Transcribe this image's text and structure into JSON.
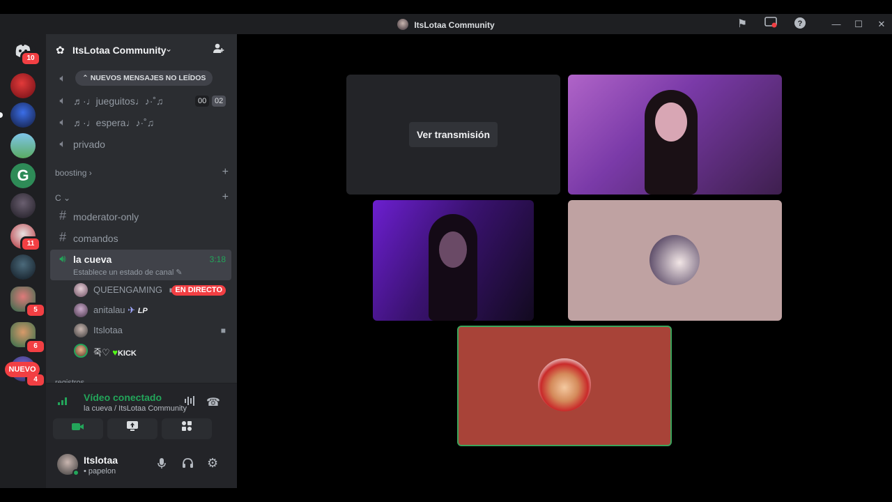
{
  "window": {
    "title": "ItsLotaa Community",
    "icons": [
      "flag-icon",
      "screen-record-icon",
      "help-icon"
    ],
    "controls": [
      "minimize",
      "maximize",
      "close"
    ]
  },
  "rail": {
    "home_badge": "10",
    "badges": [
      "11",
      "5",
      "6",
      "4"
    ],
    "nuevo_label": "NUEVO"
  },
  "server": {
    "name": "ItsLotaa Community",
    "unread_pill": "NUEVOS MENSAJES NO LEÍDOS",
    "channels": [
      {
        "name": "♬·♩jueguitos♩♪·˚♫",
        "type": "voice",
        "counter_left": "00",
        "counter_right": "02"
      },
      {
        "name": "♬·♩espera♩♪·˚♫",
        "type": "voice"
      },
      {
        "name": "privado",
        "type": "voice-locked"
      }
    ],
    "categories": [
      {
        "name": "boosting"
      },
      {
        "name": "C"
      }
    ],
    "text_channels": [
      "moderator-only",
      "comandos"
    ],
    "active_voice": {
      "name": "la cueva",
      "time": "3:18",
      "status": "Establece un estado de canal"
    },
    "voice_users": [
      {
        "name": "QUEENGAMING",
        "live": "EN DIRECTO"
      },
      {
        "name": "anitalau",
        "tag": "LP"
      },
      {
        "name": "Itslotaa"
      },
      {
        "name": "죽♡",
        "tag": "KICK"
      }
    ],
    "next_category": "registros"
  },
  "voice_panel": {
    "title": "Vídeo conectado",
    "subtitle": "la cueva / ItsLotaa Community"
  },
  "user_panel": {
    "name": "Itslotaa",
    "status": "• papelon"
  },
  "stage": {
    "watch_label": "Ver transmisión"
  },
  "colors": {
    "online_green": "#23a55a",
    "live_red": "#f23f43",
    "tile_mauve": "#bfa2a2",
    "tile_red": "#a84338"
  }
}
